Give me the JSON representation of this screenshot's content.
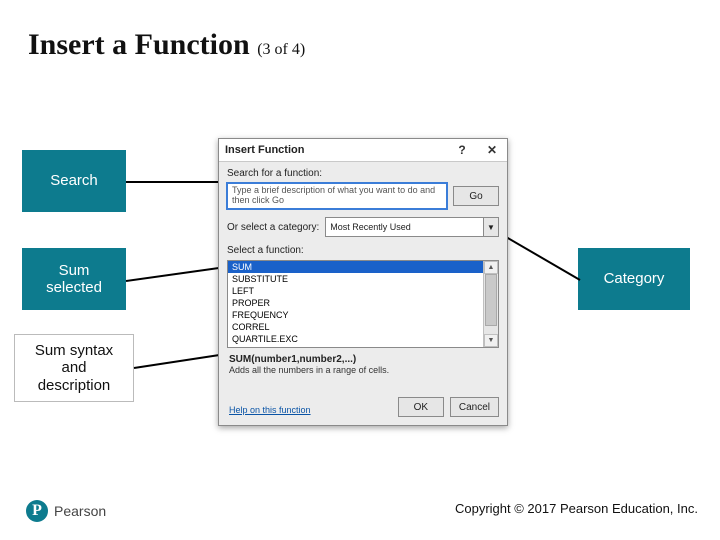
{
  "slide": {
    "title": "Insert a Function",
    "subtitle": "(3 of 4)"
  },
  "callouts": {
    "search": "Search",
    "sum_selected_l1": "Sum",
    "sum_selected_l2": "selected",
    "category": "Category",
    "syntax_l1": "Sum syntax",
    "syntax_l2": "and",
    "syntax_l3": "description"
  },
  "dialog": {
    "title": "Insert Function",
    "help_icon": "?",
    "close_icon": "✕",
    "labels": {
      "search": "Search for a function:",
      "category_prefix": "Or select a category:",
      "select": "Select a function:"
    },
    "search_text": "Type a brief description of what you want to do and then click Go",
    "go_label": "Go",
    "category_value": "Most Recently Used",
    "functions": {
      "selected": "SUM",
      "rest": [
        "SUBSTITUTE",
        "LEFT",
        "PROPER",
        "FREQUENCY",
        "CORREL",
        "QUARTILE.EXC"
      ]
    },
    "syntax": "SUM(number1,number2,...)",
    "description": "Adds all the numbers in a range of cells.",
    "help_link": "Help on this function",
    "ok_label": "OK",
    "cancel_label": "Cancel"
  },
  "footer": {
    "copyright": "Copyright © 2017 Pearson Education, Inc.",
    "brand": "Pearson",
    "brand_initial": "P"
  }
}
